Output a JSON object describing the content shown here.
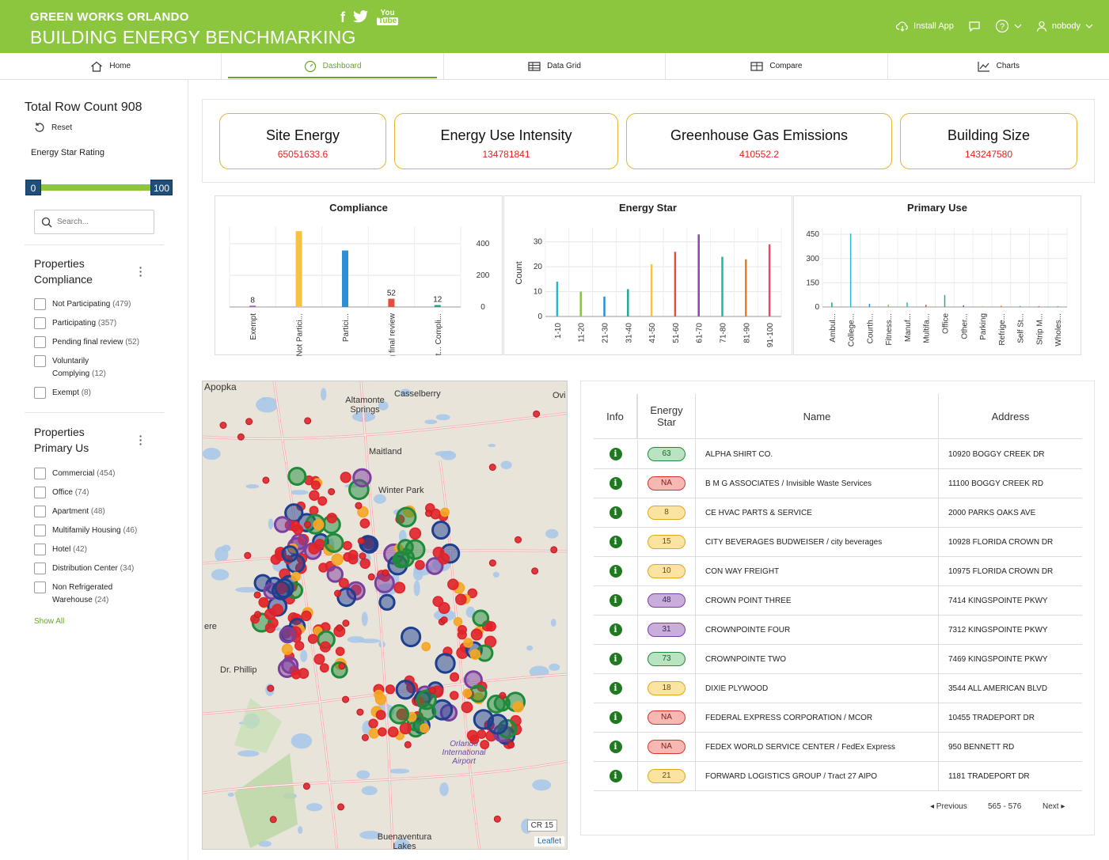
{
  "header": {
    "brand_line1": "GREEN WORKS ORLANDO",
    "brand_line2": "BUILDING ENERGY BENCHMARKING",
    "install_app": "Install App",
    "user": "nobody"
  },
  "tabs": [
    {
      "label": "Home"
    },
    {
      "label": "Dashboard"
    },
    {
      "label": "Data Grid"
    },
    {
      "label": "Compare"
    },
    {
      "label": "Charts"
    }
  ],
  "sidebar": {
    "total_row_count": "Total Row Count 908",
    "reset": "Reset",
    "energy_star_label": "Energy Star Rating",
    "slider_min": "0",
    "slider_max": "100",
    "search_placeholder": "Search...",
    "compliance_title_1": "Properties",
    "compliance_title_2": "Compliance",
    "compliance_items": [
      {
        "label": "Not Participating",
        "count": "(479)"
      },
      {
        "label": "Participating",
        "count": "(357)"
      },
      {
        "label": "Pending final review",
        "count": "(52)"
      },
      {
        "label": "Voluntarily",
        "label2": "Complying",
        "count": "(12)"
      },
      {
        "label": "Exempt",
        "count": "(8)"
      }
    ],
    "primary_title_1": "Properties",
    "primary_title_2": "Primary Us",
    "primary_items": [
      {
        "label": "Commercial",
        "count": "(454)"
      },
      {
        "label": "Office",
        "count": "(74)"
      },
      {
        "label": "Apartment",
        "count": "(48)"
      },
      {
        "label": "Multifamily Housing",
        "count": "(46)"
      },
      {
        "label": "Hotel",
        "count": "(42)"
      },
      {
        "label": "Distribution Center",
        "count": "(34)"
      },
      {
        "label": "Non Refrigerated",
        "label2": "Warehouse",
        "count": "(24)"
      }
    ],
    "show_all": "Show All"
  },
  "kpis": [
    {
      "title": "Site Energy",
      "value": "65051633.6"
    },
    {
      "title": "Energy Use Intensity",
      "value": "134781841"
    },
    {
      "title": "Greenhouse Gas Emissions",
      "value": "410552.2"
    },
    {
      "title": "Building Size",
      "value": "143247580"
    }
  ],
  "chart_data": [
    {
      "type": "bar",
      "title": "Compliance",
      "categories": [
        "Exempt",
        "Not Partici...",
        "Partici...",
        "Pending final review",
        "Volunt... Compli..."
      ],
      "values": [
        8,
        479,
        357,
        52,
        12
      ],
      "data_labels": [
        "8",
        "",
        "",
        "52",
        "12"
      ],
      "colors": [
        "#9b59b6",
        "#f5c242",
        "#2e8fd4",
        "#e74c3c",
        "#1aa388"
      ],
      "ylim": [
        0,
        500
      ],
      "yticks": [
        "400",
        "200",
        "0"
      ],
      "yaxis_side": "right"
    },
    {
      "type": "bar",
      "title": "Energy Star",
      "categories": [
        "1-10",
        "11-20",
        "21-30",
        "31-40",
        "41-50",
        "51-60",
        "61-70",
        "71-80",
        "81-90",
        "91-100"
      ],
      "values": [
        14,
        10,
        8,
        11,
        21,
        26,
        33,
        24,
        23,
        29
      ],
      "colors": [
        "#2ab7ca",
        "#8bc34a",
        "#2e8fd4",
        "#26a69a",
        "#f5c242",
        "#e74c3c",
        "#8e44ad",
        "#1abc9c",
        "#e67e22",
        "#e84a5f"
      ],
      "ylabel": "Count",
      "ylim": [
        0,
        35
      ],
      "yticks": [
        "30",
        "20",
        "10",
        "0"
      ]
    },
    {
      "type": "bar",
      "title": "Primary Use",
      "categories": [
        "Ambul...",
        "College...",
        "Courth...",
        "Fitness...",
        "Manuf...",
        "Multifa...",
        "Office",
        "Other...",
        "Parking",
        "Refrige...",
        "Self St...",
        "Strip M...",
        "Wholes..."
      ],
      "values": [
        28,
        454,
        20,
        14,
        28,
        14,
        74,
        10,
        6,
        8,
        6,
        5,
        4
      ],
      "colors": [
        "#1aa388",
        "#2ab7ca",
        "#2e8fd4",
        "#8bc34a",
        "#2ab7ca",
        "#e74c3c",
        "#26a69a",
        "#8e44ad",
        "#f5c242",
        "#e67e22",
        "#1abc9c",
        "#e84a5f",
        "#2e8fd4"
      ],
      "ylim": [
        0,
        480
      ],
      "yticks": [
        "450",
        "300",
        "150",
        "0"
      ]
    }
  ],
  "map": {
    "labels": [
      "Apopka",
      "Altamonte Springs",
      "Casselberry",
      "Ovi",
      "Maitland",
      "Winter Park",
      "ere",
      "Dr. Phillip",
      "Orlando International Airport",
      "Buenaventura Lakes"
    ],
    "road_labels": [
      "CR 15"
    ],
    "attribution": "Leaflet"
  },
  "table": {
    "headers": {
      "info": "Info",
      "energy_star_1": "Energy",
      "energy_star_2": "Star",
      "name": "Name",
      "address": "Address"
    },
    "rows": [
      {
        "es": "63",
        "name": "ALPHA SHIRT CO.",
        "address": "10920 BOGGY CREEK DR",
        "color": "green"
      },
      {
        "es": "NA",
        "name": "B M G ASSOCIATES / Invisible Waste Services",
        "address": "11100 BOGGY CREEK RD",
        "color": "red"
      },
      {
        "es": "8",
        "name": "CE HVAC PARTS & SERVICE",
        "address": "2000 PARKS OAKS AVE",
        "color": "yellow"
      },
      {
        "es": "15",
        "name": "CITY BEVERAGES BUDWEISER / city beverages",
        "address": "10928 FLORIDA CROWN DR",
        "color": "yellow"
      },
      {
        "es": "10",
        "name": "CON WAY FREIGHT",
        "address": "10975 FLORIDA CROWN DR",
        "color": "yellow"
      },
      {
        "es": "48",
        "name": "CROWN POINT THREE",
        "address": "7414 KINGSPOINTE PKWY",
        "color": "purple"
      },
      {
        "es": "31",
        "name": "CROWNPOINTE FOUR",
        "address": "7312 KINGSPOINTE PKWY",
        "color": "purple"
      },
      {
        "es": "73",
        "name": "CROWNPOINTE TWO",
        "address": "7469 KINGSPOINTE PKWY",
        "color": "green"
      },
      {
        "es": "18",
        "name": "DIXIE PLYWOOD",
        "address": "3544 ALL AMERICAN BLVD",
        "color": "yellow"
      },
      {
        "es": "NA",
        "name": "FEDERAL EXPRESS CORPORATION / MCOR",
        "address": "10455 TRADEPORT DR",
        "color": "red"
      },
      {
        "es": "NA",
        "name": "FEDEX WORLD SERVICE CENTER / FedEx Express",
        "address": "950 BENNETT RD",
        "color": "red"
      },
      {
        "es": "21",
        "name": "FORWARD LOGISTICS GROUP / Tract 27 AIPO",
        "address": "1181 TRADEPORT DR",
        "color": "yellow"
      }
    ],
    "pager": {
      "previous": "◂ Previous",
      "range": "565 - 576",
      "next": "Next ▸"
    }
  },
  "colors": {
    "brand_green": "#8cc63f",
    "active_tab": "#6aa52a",
    "kpi_border": "#e4b431",
    "kpi_value": "#e0241b",
    "pill_green": "#1f8a3a",
    "pill_red": "#d9342b",
    "pill_yellow": "#e0a81e",
    "pill_purple": "#7b3fa0"
  }
}
